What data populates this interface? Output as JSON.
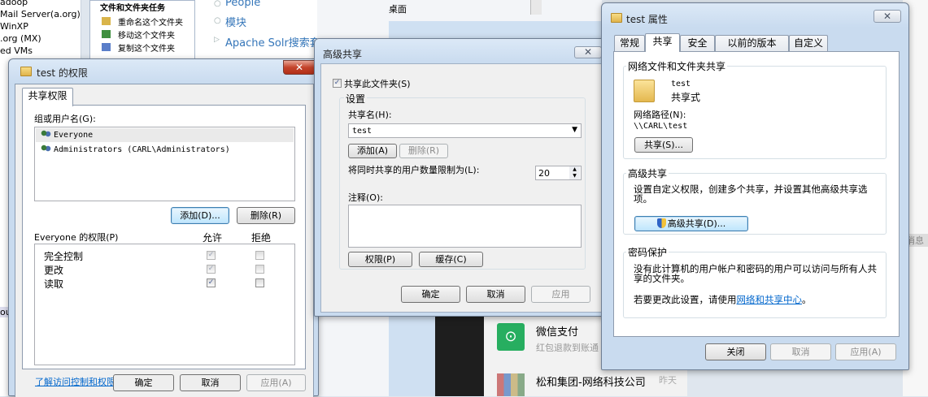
{
  "bg": {
    "left_list": [
      "adoop",
      "Mail Server(a.org)",
      "WinXP",
      ".org (MX)",
      "ed VMs"
    ],
    "left_bottom": "ou",
    "tasks_title": "文件和文件夹任务",
    "tasks": [
      "重命名这个文件夹",
      "移动这个文件夹",
      "复制这个文件夹"
    ],
    "links": [
      "People",
      "模块",
      "Apache Solr搜索套"
    ],
    "desktop_label": "桌面",
    "right_edge": "消息",
    "chat": [
      {
        "title": "微信支付",
        "sub": "红包退款到账通",
        "time": ""
      },
      {
        "title": "松和集团-网络科技公司",
        "sub": "",
        "time": "昨天"
      }
    ]
  },
  "perm": {
    "title": "test 的权限",
    "close": "✕",
    "tab": "共享权限",
    "group_label": "组或用户名(G):",
    "users": [
      "Everyone",
      "Administrators (CARL\\Administrators)"
    ],
    "add": "添加(D)...",
    "remove": "删除(R)",
    "perm_header": "Everyone 的权限(P)",
    "allow": "允许",
    "deny": "拒绝",
    "rows": [
      "完全控制",
      "更改",
      "读取"
    ],
    "link": "了解访问控制和权限",
    "ok": "确定",
    "cancel": "取消",
    "apply": "应用(A)"
  },
  "adv": {
    "title": "高级共享",
    "close": "✕",
    "share_check": "共享此文件夹(S)",
    "settings": "设置",
    "share_name_label": "共享名(H):",
    "share_name": "test",
    "add": "添加(A)",
    "remove": "删除(R)",
    "limit_label": "将同时共享的用户数量限制为(L):",
    "limit_value": "20",
    "comment_label": "注释(O):",
    "perm_btn": "权限(P)",
    "cache_btn": "缓存(C)",
    "ok": "确定",
    "cancel": "取消",
    "apply": "应用"
  },
  "props": {
    "title": "test 属性",
    "close": "✕",
    "tabs": [
      "常规",
      "共享",
      "安全",
      "以前的版本",
      "自定义"
    ],
    "net_group": "网络文件和文件夹共享",
    "folder_name": "test",
    "folder_state": "共享式",
    "path_label": "网络路径(N):",
    "path": "\\\\CARL\\test",
    "share_btn": "共享(S)...",
    "adv_group": "高级共享",
    "adv_desc": "设置自定义权限，创建多个共享，并设置其他高级共享选项。",
    "adv_btn": "高级共享(D)...",
    "pwd_group": "密码保护",
    "pwd_desc": "没有此计算机的用户帐户和密码的用户可以访问与所有人共享的文件夹。",
    "pwd_change_prefix": "若要更改此设置，请使用",
    "pwd_link": "网络和共享中心",
    "pwd_change_suffix": "。",
    "close_btn": "关闭",
    "cancel": "取消",
    "apply": "应用(A)"
  }
}
